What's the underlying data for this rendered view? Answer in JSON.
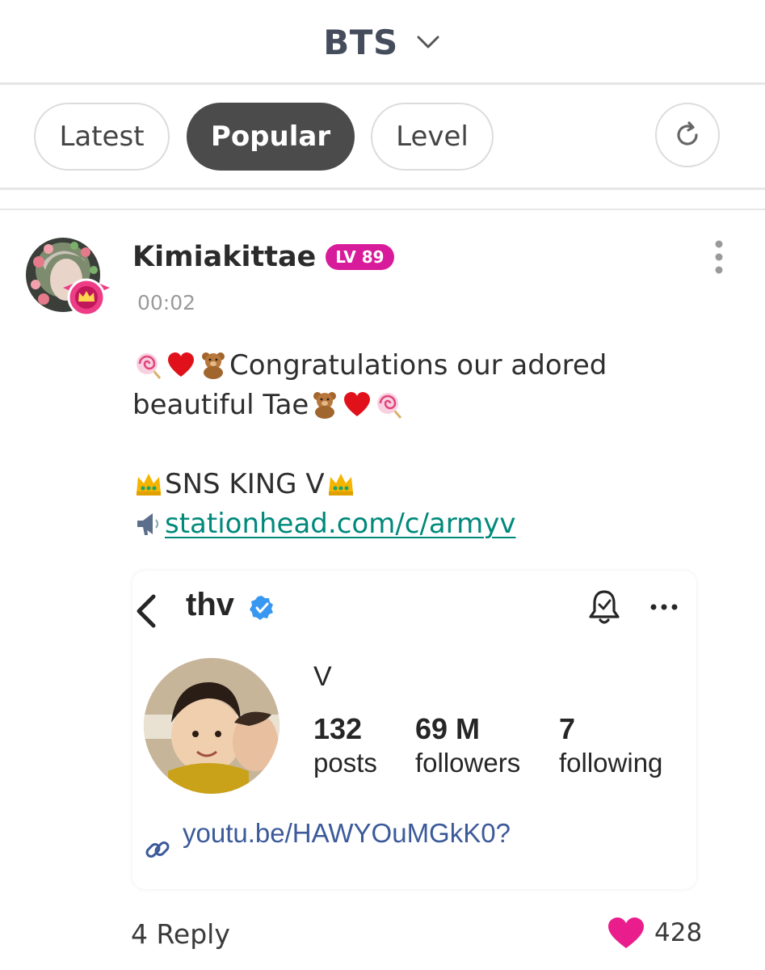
{
  "header": {
    "community": "BTS",
    "dropdown_icon": "chevron-down-icon"
  },
  "tabs": [
    {
      "label": "Latest",
      "active": false
    },
    {
      "label": "Popular",
      "active": true
    },
    {
      "label": "Level",
      "active": false
    }
  ],
  "post": {
    "author": "Kimiakittae",
    "level": "LV 89",
    "time": "00:02",
    "line1": "Congratulations our adored",
    "line2": "beautiful Tae",
    "line3": "SNS KING V",
    "link": "stationhead.com/c/armyv",
    "reply_count": "4 Reply",
    "likes": "428"
  },
  "embed": {
    "username": "thv",
    "name": "V",
    "stats": [
      {
        "value": "132",
        "label": "posts"
      },
      {
        "value": "69 M",
        "label": "followers"
      },
      {
        "value": "7",
        "label": "following"
      }
    ],
    "link": "youtu.be/HAWYOuMGkK0?"
  },
  "colors": {
    "accent": "#d81b9a",
    "link": "#00897b",
    "active_tab": "#4b4b4b",
    "heart": "#e91e8c"
  }
}
